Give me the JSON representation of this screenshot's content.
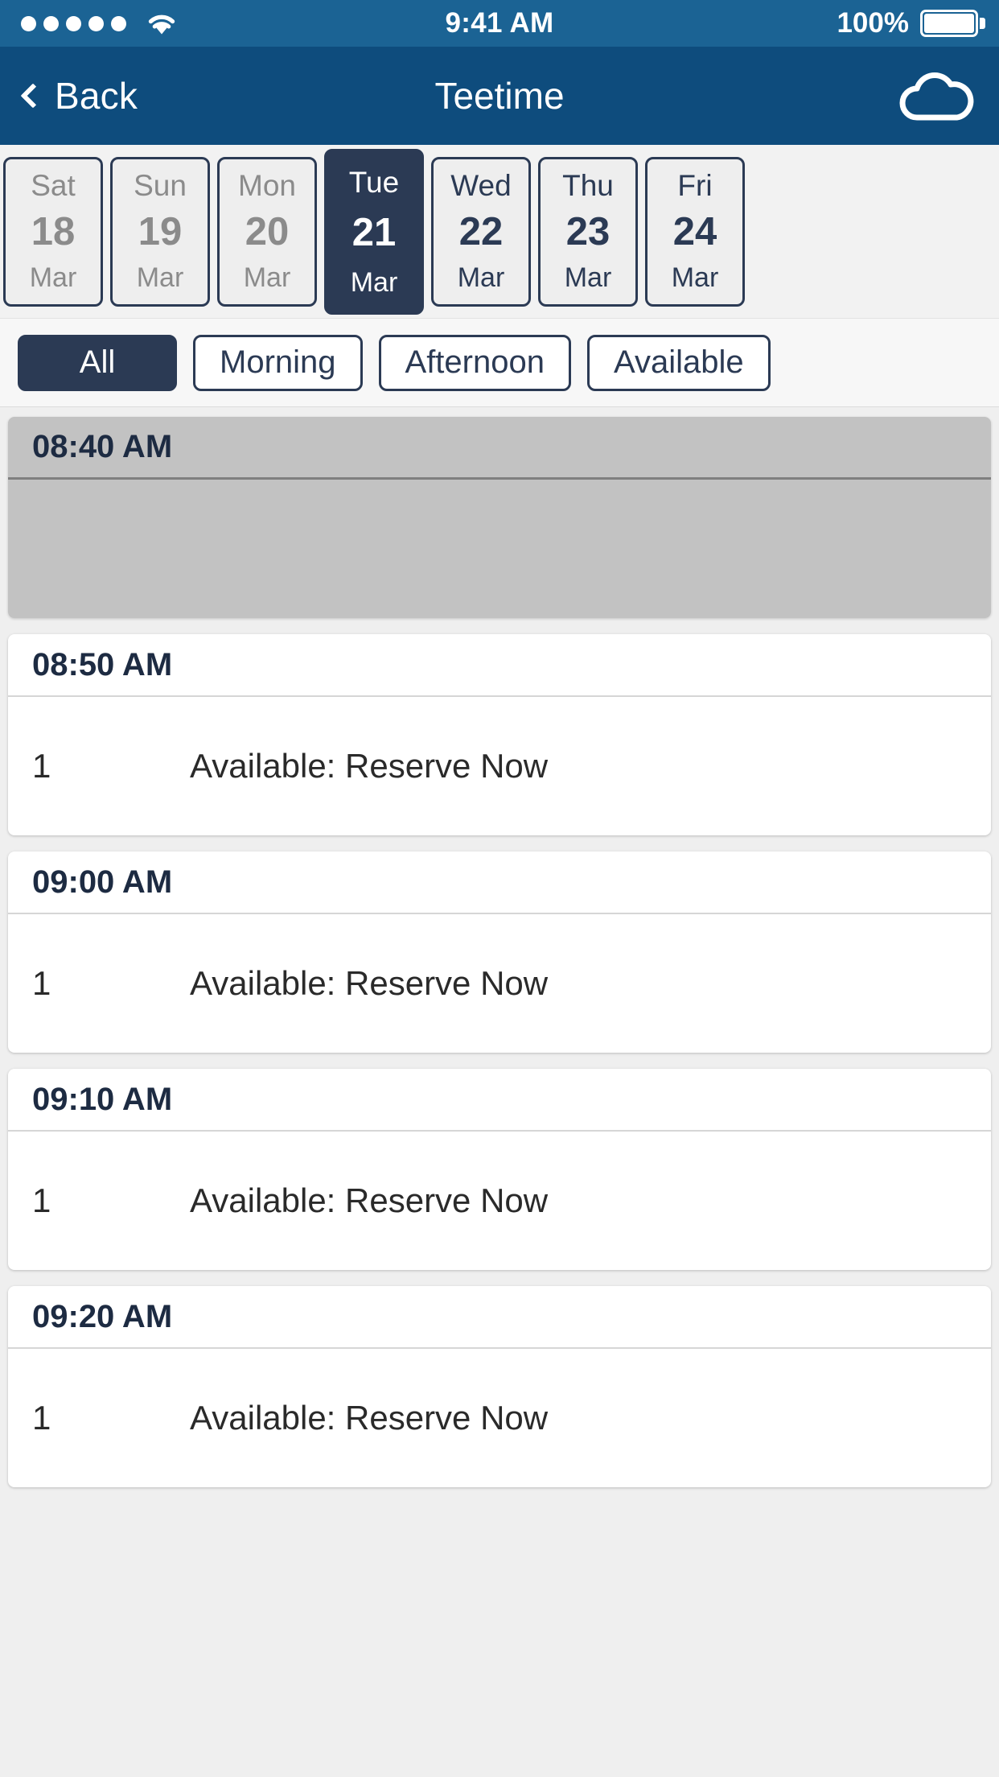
{
  "status_bar": {
    "signal_dots": 5,
    "wifi_icon": "wifi-icon",
    "time": "9:41 AM",
    "battery_percent": "100%",
    "battery_icon": "battery-full-icon"
  },
  "nav_bar": {
    "back_label": "Back",
    "back_icon": "chevron-left-icon",
    "title": "Teetime",
    "right_icon": "cloud-icon"
  },
  "date_strip": {
    "dates": [
      {
        "dow": "Sat",
        "day": "18",
        "month": "Mar",
        "state": "past"
      },
      {
        "dow": "Sun",
        "day": "19",
        "month": "Mar",
        "state": "past"
      },
      {
        "dow": "Mon",
        "day": "20",
        "month": "Mar",
        "state": "past"
      },
      {
        "dow": "Tue",
        "day": "21",
        "month": "Mar",
        "state": "selected"
      },
      {
        "dow": "Wed",
        "day": "22",
        "month": "Mar",
        "state": "future"
      },
      {
        "dow": "Thu",
        "day": "23",
        "month": "Mar",
        "state": "future"
      },
      {
        "dow": "Fri",
        "day": "24",
        "month": "Mar",
        "state": "future"
      }
    ]
  },
  "filters": {
    "tabs": [
      {
        "label": "All",
        "active": true
      },
      {
        "label": "Morning",
        "active": false
      },
      {
        "label": "Afternoon",
        "active": false
      },
      {
        "label": "Available",
        "active": false
      }
    ]
  },
  "slots": [
    {
      "time": "08:40 AM",
      "available": false,
      "count": "",
      "status": ""
    },
    {
      "time": "08:50 AM",
      "available": true,
      "count": "1",
      "status": "Available: Reserve Now"
    },
    {
      "time": "09:00 AM",
      "available": true,
      "count": "1",
      "status": "Available: Reserve Now"
    },
    {
      "time": "09:10 AM",
      "available": true,
      "count": "1",
      "status": "Available: Reserve Now"
    },
    {
      "time": "09:20 AM",
      "available": true,
      "count": "1",
      "status": "Available: Reserve Now"
    }
  ],
  "colors": {
    "status_bar_blue": "#1b6394",
    "nav_bar_blue": "#0e4c7d",
    "accent_navy": "#2b3a54",
    "page_background": "#efefef",
    "unavailable_gray": "#c2c2c2"
  }
}
